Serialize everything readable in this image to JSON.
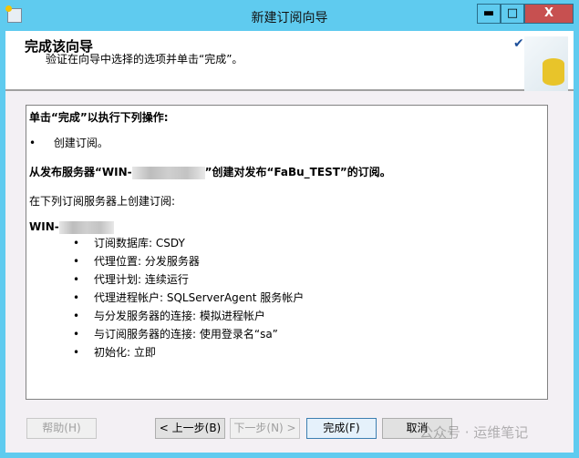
{
  "window": {
    "title": "新建订阅向导",
    "min": "▬",
    "max": "□",
    "close": "X"
  },
  "header": {
    "title": "完成该向导",
    "subtitle": "验证在向导中选择的选项并单击“完成”。",
    "check": "✔"
  },
  "summary": {
    "intro": "单击“完成”以执行下列操作:",
    "action": "创建订阅。",
    "publisher_prefix": "从发布服务器“WIN-",
    "publisher_suffix": "”创建对发布“FaBu_TEST”的订阅。",
    "subscriber_label": "在下列订阅服务器上创建订阅:",
    "subscriber_prefix": "WIN-",
    "details": [
      "订阅数据库: CSDY",
      "代理位置: 分发服务器",
      "代理计划: 连续运行",
      "代理进程帐户: SQLServerAgent 服务帐户",
      "与分发服务器的连接: 模拟进程帐户",
      "与订阅服务器的连接: 使用登录名“sa”",
      "初始化: 立即"
    ]
  },
  "footer": {
    "help": "帮助(H)",
    "back": "< 上一步(B)",
    "next": "下一步(N) >",
    "finish": "完成(F)",
    "cancel": "取消"
  },
  "watermark": "公众号 · 运维笔记"
}
